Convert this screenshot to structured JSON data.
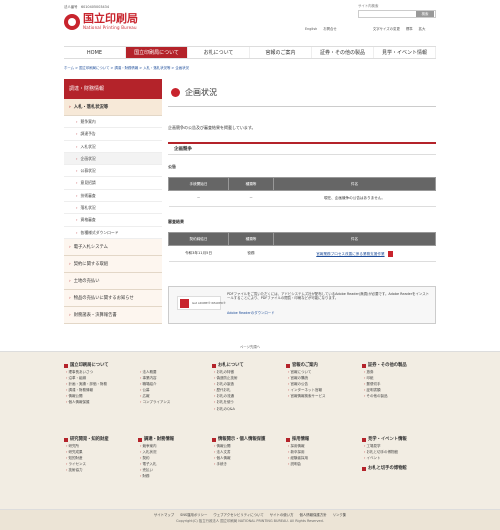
{
  "header": {
    "corp_number": "法人番号　6010405003434",
    "logo_jp": "国立印刷局",
    "logo_en": "National Printing Bureau",
    "search_label": "サイト内検索",
    "search_placeholder": "",
    "search_button": "検索",
    "util_links": [
      "English",
      "お問合せ",
      "文字サイズの変更",
      "標準",
      "拡大"
    ]
  },
  "nav": [
    "HOME",
    "国立印刷局について",
    "お札について",
    "官報のご案内",
    "証券・その他の製品",
    "見学・イベント情報"
  ],
  "breadcrumb": "ホーム > 国立印刷局について > 調達・財務情報 > 入札・落札状況等 > 企画状況",
  "sidebar": {
    "title": "調達・財務情報",
    "open": "入札・落札状況等",
    "subs": [
      "競争案内",
      "調達予告",
      "入札状況",
      "企画状況",
      "公募状況",
      "意見招請",
      "技術審査",
      "落札状況",
      "資格審査",
      "各種様式ダウンロード"
    ],
    "groups": [
      "電子入札システム",
      "契約に関する取組",
      "土地の売払い",
      "物品の売払いに関するお知らせ",
      "財務諸表・決算報告書"
    ]
  },
  "main": {
    "title": "企画状況",
    "intro": "企画競争の公告及び審査結果を掲載しています。",
    "section": "企画競争",
    "label_notice": "公告",
    "table1_head": [
      "手続開始日",
      "種類等",
      "件名"
    ],
    "table1_row": [
      "－",
      "－",
      "現在、企画競争の公告はありません。"
    ],
    "label_result": "審査結果",
    "table2_head": [
      "契約締結日",
      "種類等",
      "件名"
    ],
    "table2_row": [
      "令和3年11月5日",
      "役務",
      "官報業務プロセス改善に係る業務支援作業"
    ],
    "pdf_text": "PDFファイルをご覧いただくには、アドビシステムズ社が配布しているAdobe Reader(無償)が必要です。Adobe Readerをインストールすることにより、PDFファイルの閲覧・印刷などが可能になります。",
    "adobe_badge": "Get ADOBE® READER®",
    "adobe_link": "Adobe Readerのダウンロード"
  },
  "to_top": "ページ先頭へ",
  "footer": {
    "cols": [
      {
        "h": "国立印刷局について",
        "items": [
          "理事長あいさつ",
          "沿革・組織",
          "計画・実績・評価・財務",
          "調達・財務情報",
          "情報公開",
          "個人情報保護"
        ]
      },
      {
        "h": "",
        "items": [
          "法人概要",
          "事業内容",
          "職場紹介",
          "公募",
          "広報",
          "コンプライアンス"
        ]
      },
      {
        "h": "お札について",
        "items": [
          "お札の特徴",
          "偽造防止技術",
          "お札の製造",
          "歴代お札",
          "お札の流通",
          "お札を使う",
          "お札のQ&A"
        ]
      },
      {
        "h": "官報のご案内",
        "items": [
          "官報について",
          "官報の購読",
          "官報の公告",
          "インターネット官報",
          "官報情報検索サービス"
        ]
      },
      {
        "h": "証券・その他の製品",
        "items": [
          "旅券",
          "印紙",
          "郵便切手",
          "証明書類",
          "その他の製品"
        ]
      },
      {
        "h": "研究開発・知的財産",
        "items": [
          "研究所",
          "研究成果",
          "知的財産",
          "ライセンス",
          "技術協力"
        ]
      },
      {
        "h": "調達・財務情報",
        "items": [
          "競争案内",
          "入札状況",
          "契約",
          "電子入札",
          "売払い",
          "財務"
        ]
      },
      {
        "h": "情報開示・個人情報保護",
        "items": [
          "情報公開",
          "法人文書",
          "個人情報",
          "手続き"
        ]
      },
      {
        "h": "採用情報",
        "items": [
          "採用情報",
          "新卒採用",
          "経験者採用",
          "説明会"
        ]
      },
      {
        "h": "見学・イベント情報",
        "items": [
          "工場見学",
          "お札と切手の博物館",
          "イベント"
        ]
      }
    ],
    "col11_h": "お札と切手の博物館",
    "bar_links": [
      "サイトマップ",
      "SNS運用ポリシー",
      "ウェブアクセシビリティについて",
      "サイトの使い方",
      "個人情報保護方針",
      "リンク集"
    ],
    "copyright": "Copyright(C) 独立行政法人 国立印刷局 NATIONAL PRINTING BUREAU. All Rights Reserved."
  },
  "colors": {
    "brand": "#b4232a"
  }
}
